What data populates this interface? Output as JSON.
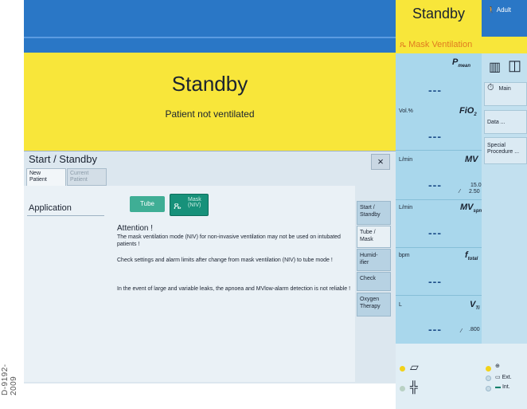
{
  "side_code": "D-9192-2009",
  "status": {
    "title": "Standby",
    "subtitle": "Patient not ventilated",
    "right_title": "Standby",
    "patient_type": "Adult",
    "mode": "Mask Ventilation"
  },
  "dialog": {
    "title": "Start / Standby",
    "close_label": "×",
    "tabs": [
      {
        "line1": "New",
        "line2": "Patient"
      },
      {
        "line1": "Current",
        "line2": "Patient"
      }
    ],
    "application_label": "Application",
    "tube_label": "Tube",
    "mask_label_1": "Mask",
    "mask_label_2": "(NIV)",
    "attention_title": "Attention !",
    "messages": [
      "The mask ventilation mode (NIV) for non-invasive ventilation may not be used on intubated patients !",
      "Check settings and alarm limits after change from mask ventilation (NIV) to tube mode !",
      "In the event of large and variable leaks, the apnoea and MVlow-alarm detection is not reliable !"
    ],
    "side_buttons": [
      {
        "line1": "Start /",
        "line2": "Standby"
      },
      {
        "line1": "Tube /",
        "line2": "Mask"
      },
      {
        "line1": "Humid-",
        "line2": "ifier"
      },
      {
        "line1": "Check",
        "line2": ""
      },
      {
        "line1": "Oxygen",
        "line2": "Therapy"
      }
    ]
  },
  "parameters": [
    {
      "unit": "",
      "name": "P",
      "sub": "mean",
      "value": "---",
      "lim_hi": "",
      "lim_lo": ""
    },
    {
      "unit": "Vol.%",
      "name": "FiO",
      "sub": "2",
      "value": "---",
      "lim_hi": "",
      "lim_lo": ""
    },
    {
      "unit": "L/min",
      "name": "MV",
      "sub": "",
      "value": "---",
      "lim_hi": "15.0",
      "lim_lo": "2.50"
    },
    {
      "unit": "L/min",
      "name": "MV",
      "sub": "spn",
      "value": "---",
      "lim_hi": "",
      "lim_lo": ""
    },
    {
      "unit": "bpm",
      "name": "f",
      "sub": "total",
      "value": "---",
      "lim_hi": "",
      "lim_lo": ""
    },
    {
      "unit": "L",
      "name": "V",
      "sub": "Ti",
      "value": "---",
      "lim_hi": ".800",
      "lim_lo": ""
    }
  ],
  "right_menu": {
    "main_label": "Main",
    "data_label": "Data ...",
    "special_label_1": "Special",
    "special_label_2": "Procedure ...",
    "ext_label": "Ext.",
    "int_label": "Int."
  },
  "colors": {
    "standby_yellow": "#f8e63a",
    "header_blue": "#2a77c6",
    "button_green": "#3fae95",
    "mask_orange": "#e07b20"
  }
}
